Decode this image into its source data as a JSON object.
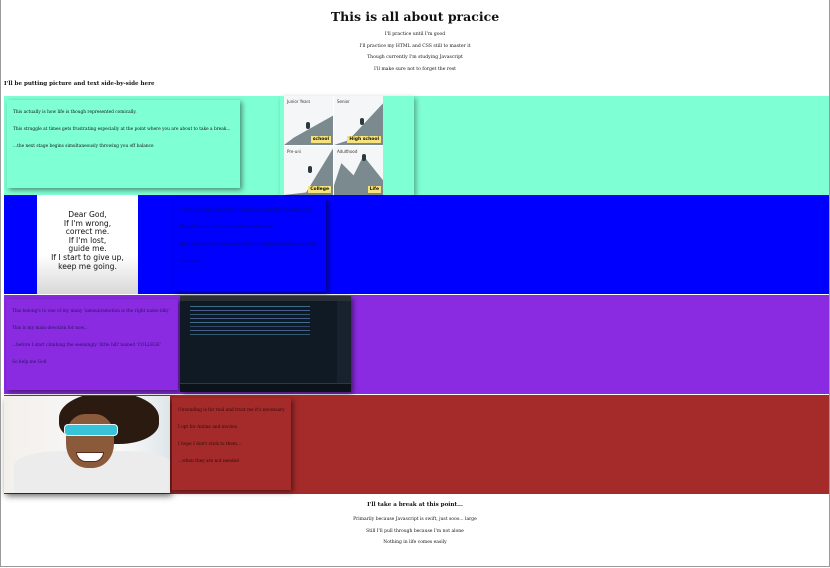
{
  "page": {
    "title": "This is all about pracice",
    "intro_lines": [
      "I'll practice until I'm good",
      "I'll practice my HTML and CSS still to master it",
      "Though currently I'm studying Javascript",
      "I'll make sure not to forget the rest"
    ],
    "subheading": "I'll be putting picture and text side-by-side here"
  },
  "sections": {
    "aqua": {
      "color": "#7fffd4",
      "paragraphs": [
        "This actually is how life is though represented comically.",
        "This struggle at times gets frustrating especially at the point where you are about to take a break...",
        "...the next stage begins simultaneously throwing you off balance"
      ],
      "image": {
        "icon": "comic-life-stages-image",
        "panels": [
          {
            "caption": "Junior Years",
            "tag": "school"
          },
          {
            "caption": "Senior",
            "tag": "High school"
          },
          {
            "caption": "Pre-uni",
            "tag": "College"
          },
          {
            "caption": "Adulthood",
            "tag": "Life"
          }
        ]
      }
    },
    "blue": {
      "color": "#0000ff",
      "image": {
        "icon": "prayer-quote-image",
        "lines": [
          "Dear God,",
          "If I'm wrong,",
          "correct me.",
          "If I'm lost,",
          "guide me.",
          "If I start to give up,",
          "keep me going."
        ]
      },
      "paragraphs": [
        "I held on to this scripture. Things are incredibly tough so far",
        "Honestly I'm not even sure how to feel now",
        "But I do know he's with me and I'll be alright regardless of the outcome"
      ]
    },
    "purple": {
      "color": "#8a2be2",
      "paragraphs": [
        "This belong's to one of my many 'iamsun(emotion is the right name idk)'",
        "This is my main devotion for now...",
        "...before I start climbing the seemingly 'little hill' named 'COLLEGE'",
        "So help me God"
      ],
      "image": {
        "icon": "code-editor-screenshot-image"
      }
    },
    "brown": {
      "color": "#a52a2a",
      "image": {
        "icon": "anime-character-image"
      },
      "paragraphs": [
        "Unwinding is for real and trust me it's necessary",
        "I opt for Anime and movies",
        "I hope I don't stick to them...",
        "...when they are not needed"
      ]
    }
  },
  "closing": {
    "title": "I'll take a break at this point...",
    "lines": [
      "Primarily because Javascript is swift, just sooo... large",
      "Still I'll pull through because I'm not alone",
      "Nothing in life comes easily"
    ]
  }
}
